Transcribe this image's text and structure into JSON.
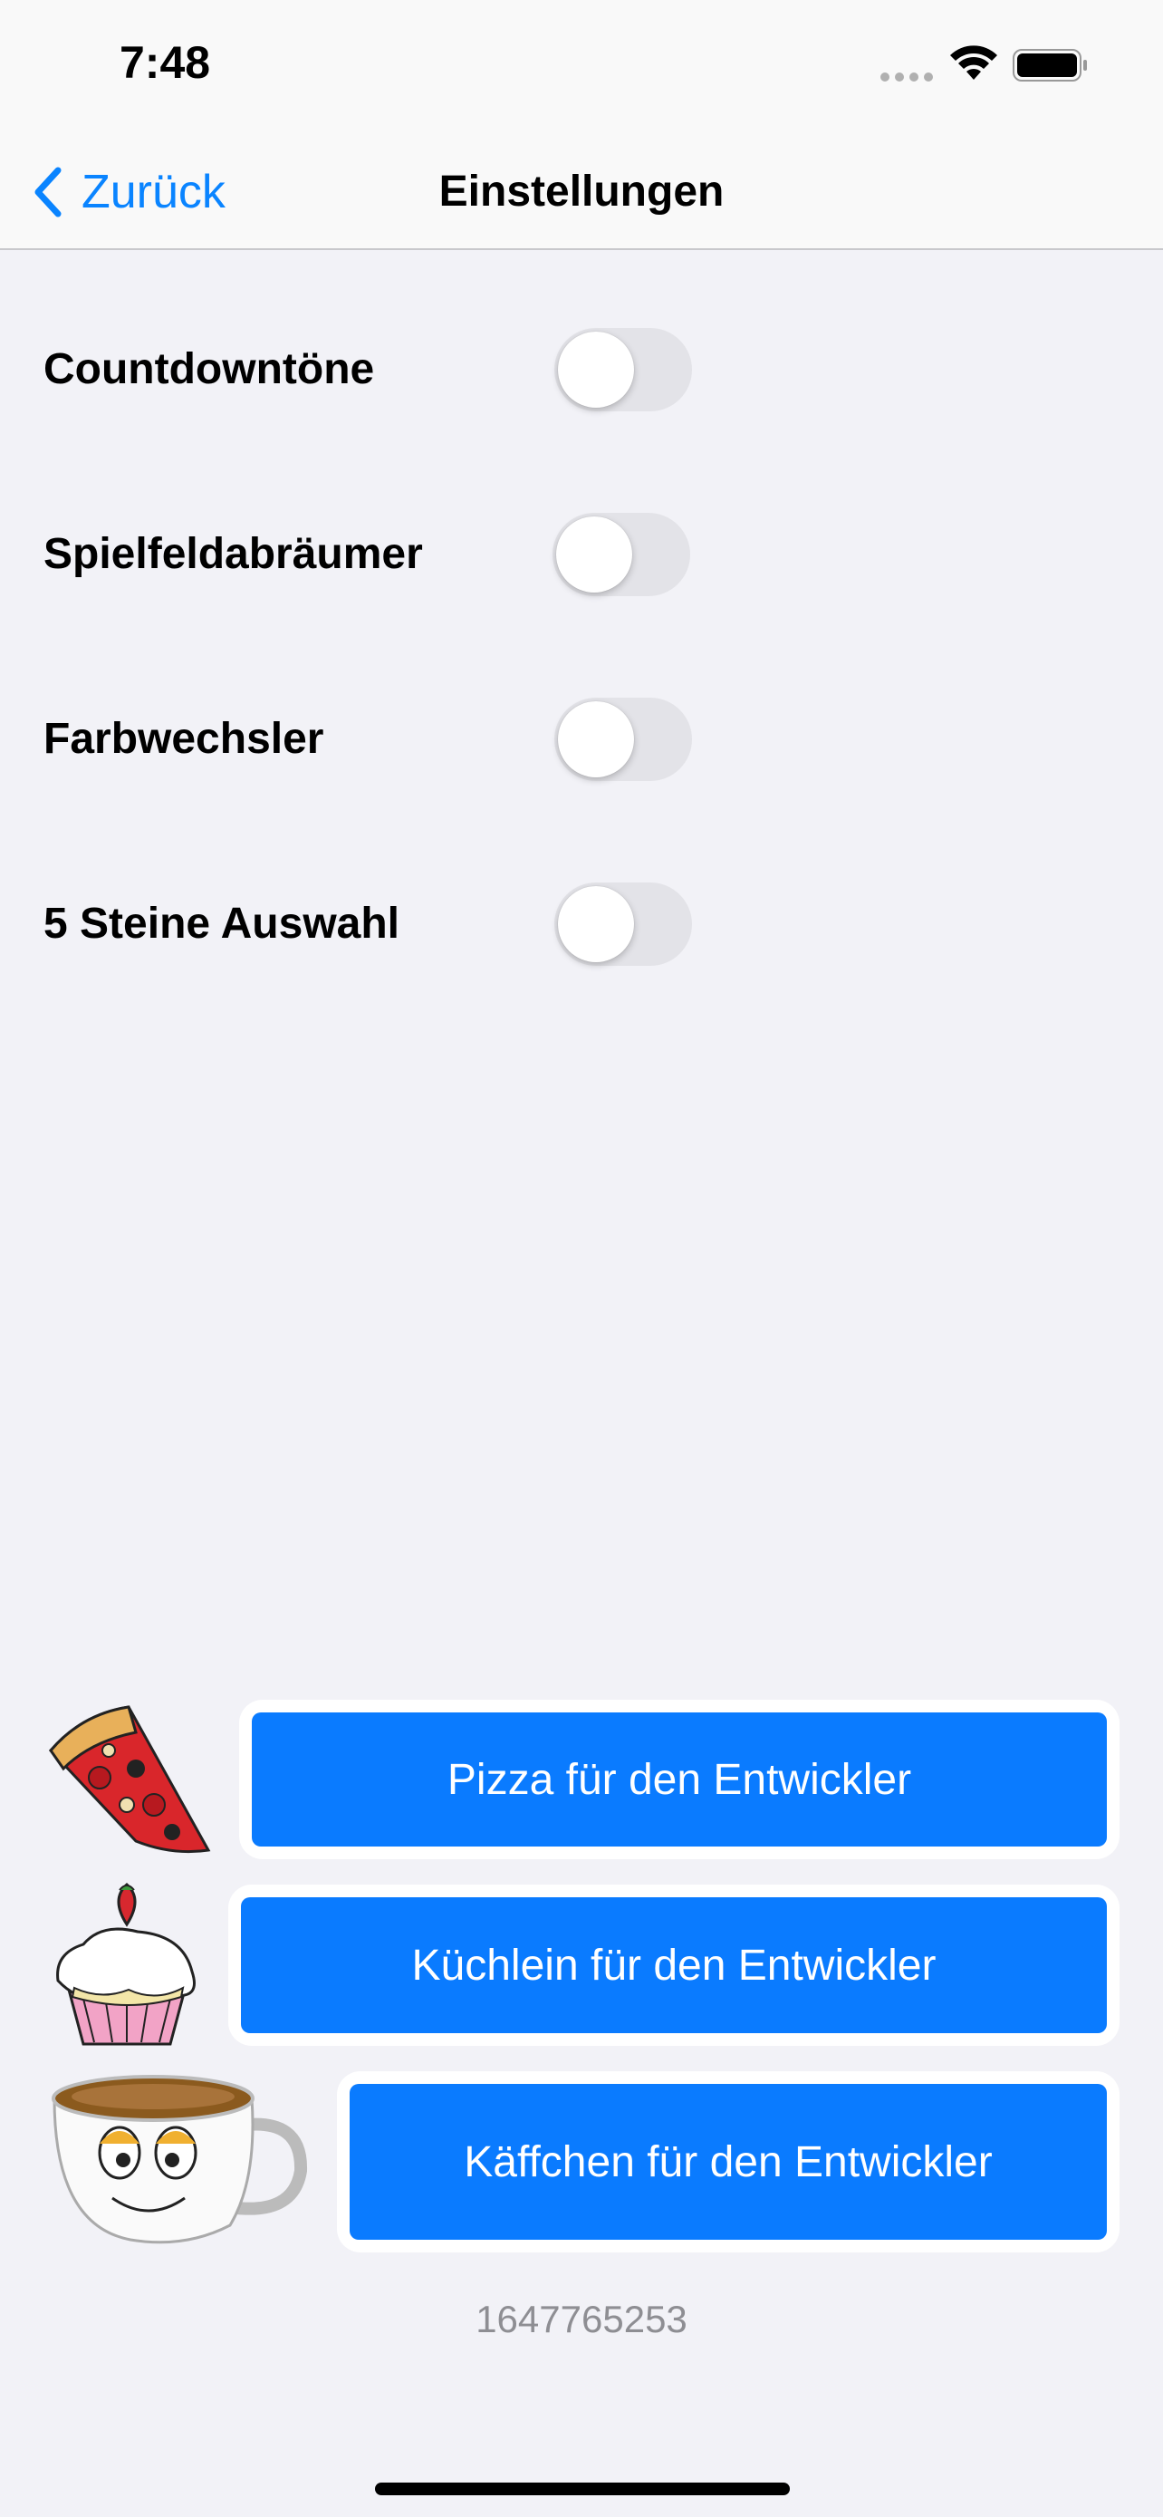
{
  "status": {
    "time": "7:48"
  },
  "nav": {
    "back_label": "Zurück",
    "title": "Einstellungen"
  },
  "settings": [
    {
      "label": "Countdowntöne",
      "enabled": false
    },
    {
      "label": "Spielfeldabräumer",
      "enabled": false
    },
    {
      "label": "Farbwechsler",
      "enabled": false
    },
    {
      "label": "5 Steine Auswahl",
      "enabled": false
    }
  ],
  "donations": [
    {
      "icon": "pizza-slice-icon",
      "label": "Pizza für den Entwickler"
    },
    {
      "icon": "cupcake-icon",
      "label": "Küchlein für den Entwickler"
    },
    {
      "icon": "coffee-cup-icon",
      "label": "Käffchen für den Entwickler"
    }
  ],
  "version": "1647765253",
  "colors": {
    "accent": "#0a7bff",
    "background": "#f2f2f7"
  }
}
